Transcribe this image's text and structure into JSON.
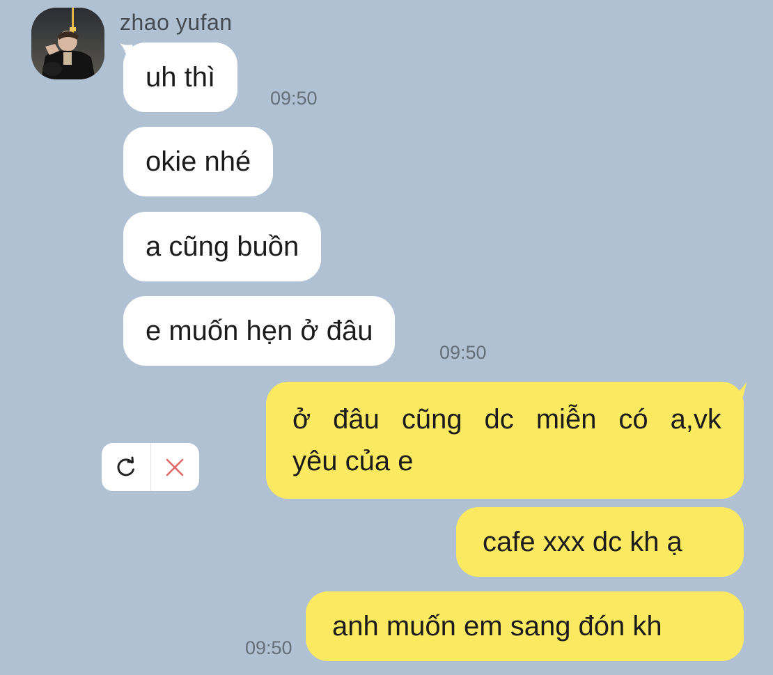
{
  "chat": {
    "sender_name": "zhao yufan",
    "incoming": [
      {
        "text": "uh thì",
        "time": "09:50"
      },
      {
        "text": "okie nhé"
      },
      {
        "text": "a cũng buồn"
      },
      {
        "text": "e muốn hẹn ở đâu",
        "time": "09:50"
      }
    ],
    "outgoing": [
      {
        "line1_words": [
          "ở",
          "đâu",
          "cũng",
          "dc",
          "miễn",
          "có",
          "a,vk"
        ],
        "line2": "yêu của e",
        "status": "failed"
      },
      {
        "text": "cafe xxx dc kh ạ"
      },
      {
        "text": "anh muốn em sang đón kh",
        "time": "09:50"
      }
    ],
    "failed_actions": {
      "retry_icon": "refresh-icon",
      "delete_icon": "close-icon"
    }
  },
  "colors": {
    "background": "#afc1d2",
    "incoming_bubble": "#ffffff",
    "outgoing_bubble": "#fbe961",
    "delete_x": "#e06a6a"
  }
}
